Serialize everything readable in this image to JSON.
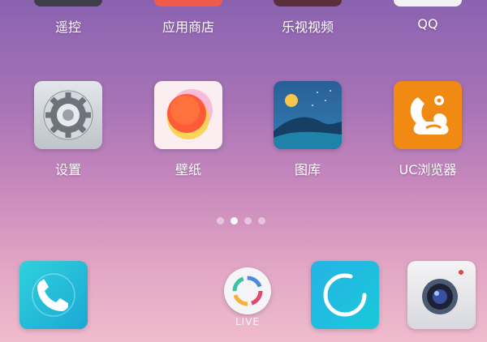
{
  "top_row": [
    {
      "label": "遥控"
    },
    {
      "label": "应用商店"
    },
    {
      "label": "乐视视频"
    },
    {
      "label": "QQ"
    }
  ],
  "second_row": [
    {
      "label": "设置",
      "icon": "settings-gear-icon"
    },
    {
      "label": "壁纸",
      "icon": "wallpaper-icon"
    },
    {
      "label": "图库",
      "icon": "gallery-icon"
    },
    {
      "label": "UC浏览器",
      "icon": "uc-browser-icon"
    }
  ],
  "page_indicator": {
    "total": 4,
    "active": 2
  },
  "dock": {
    "items": [
      {
        "icon": "phone-icon"
      },
      {
        "icon": "live-icon",
        "label": "LIVE"
      },
      {
        "icon": "browser-circle-icon"
      },
      {
        "icon": "camera-icon"
      }
    ]
  },
  "colors": {
    "uc_orange": "#f08a12",
    "phone_teal": "#21c7d6",
    "gallery_blue": "#1f5e93"
  }
}
